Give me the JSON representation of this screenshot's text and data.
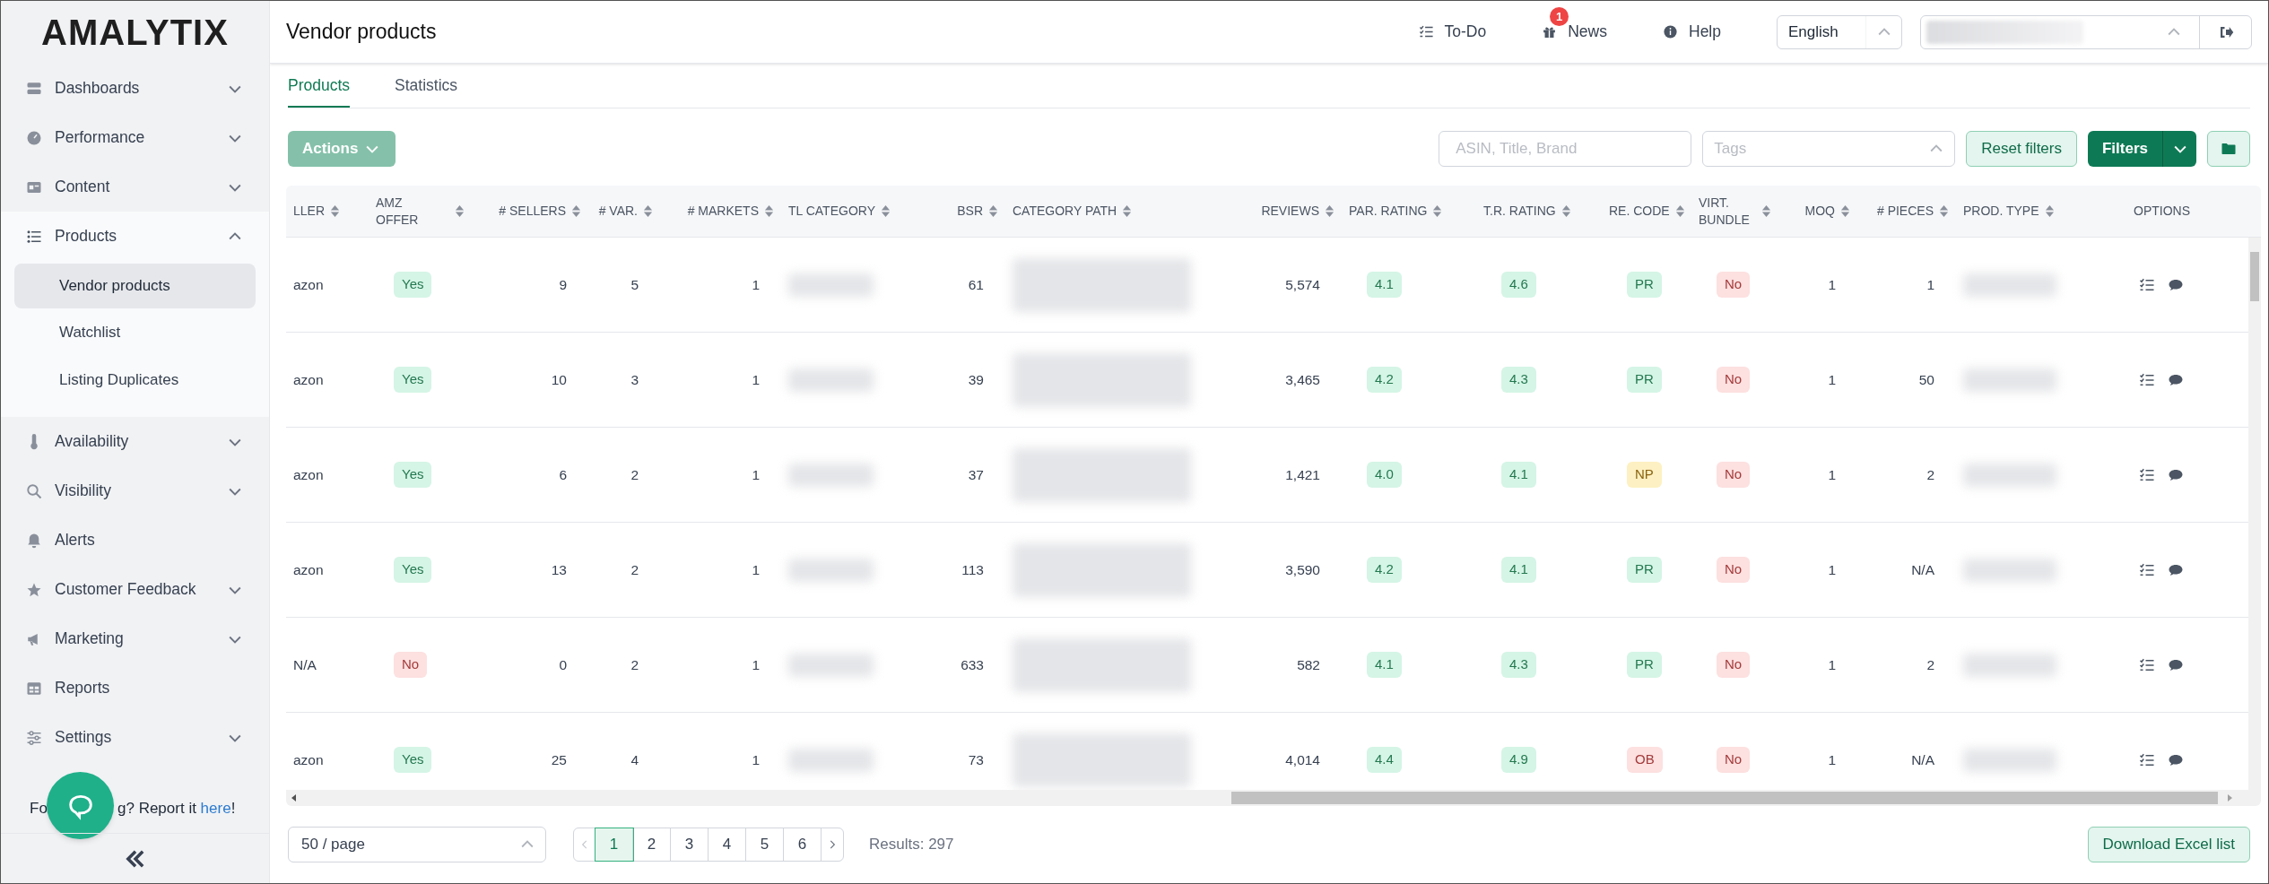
{
  "sidebar": {
    "logo": "AMALYTIX",
    "items": [
      {
        "label": "Dashboards",
        "kind": "dashboard",
        "expanded": false
      },
      {
        "label": "Performance",
        "kind": "gauge",
        "expanded": false
      },
      {
        "label": "Content",
        "kind": "card",
        "expanded": false
      },
      {
        "label": "Products",
        "kind": "list",
        "expanded": true,
        "children": [
          {
            "label": "Vendor products",
            "selected": true
          },
          {
            "label": "Watchlist",
            "selected": false
          },
          {
            "label": "Listing Duplicates",
            "selected": false
          }
        ]
      },
      {
        "label": "Availability",
        "kind": "thermometer",
        "expanded": false
      },
      {
        "label": "Visibility",
        "kind": "search",
        "expanded": false
      },
      {
        "label": "Alerts",
        "kind": "bell"
      },
      {
        "label": "Customer Feedback",
        "kind": "star",
        "expanded": false
      },
      {
        "label": "Marketing",
        "kind": "megaphone",
        "expanded": false
      },
      {
        "label": "Reports",
        "kind": "table"
      },
      {
        "label": "Settings",
        "kind": "sliders",
        "expanded": false
      }
    ],
    "report": {
      "before": "Fo",
      "after": "g? Report it ",
      "link": "here",
      "end": "!"
    }
  },
  "header": {
    "title": "Vendor products",
    "links": [
      {
        "label": "To-Do",
        "kind": "todo"
      },
      {
        "label": "News",
        "kind": "gift",
        "badge": "1"
      },
      {
        "label": "Help",
        "kind": "info"
      }
    ],
    "language": "English"
  },
  "tabs": [
    {
      "label": "Products",
      "selected": true
    },
    {
      "label": "Statistics",
      "selected": false
    }
  ],
  "toolbar": {
    "actions": "Actions",
    "search_placeholder": "ASIN, Title, Brand",
    "tags_placeholder": "Tags",
    "reset": "Reset filters",
    "filters": "Filters"
  },
  "table": {
    "columns": [
      {
        "label": "LLER",
        "kind": "text"
      },
      {
        "label": "AMZ OFFER",
        "kind": "badge"
      },
      {
        "label": "# SELLERS",
        "kind": "num"
      },
      {
        "label": "# VAR.",
        "kind": "num"
      },
      {
        "label": "# MARKETS",
        "kind": "num"
      },
      {
        "label": "TL CATEGORY",
        "kind": "blur"
      },
      {
        "label": "BSR",
        "kind": "num"
      },
      {
        "label": "CATEGORY PATH",
        "kind": "blur2"
      },
      {
        "label": "REVIEWS",
        "kind": "num"
      },
      {
        "label": "PAR. RATING",
        "kind": "badge"
      },
      {
        "label": "T.R. RATING",
        "kind": "badge"
      },
      {
        "label": "RE. CODE",
        "kind": "badge"
      },
      {
        "label": "VIRT. BUNDLE",
        "kind": "badge"
      },
      {
        "label": "MOQ",
        "kind": "num"
      },
      {
        "label": "# PIECES",
        "kind": "num"
      },
      {
        "label": "PROD. TYPE",
        "kind": "blur"
      },
      {
        "label": "OPTIONS",
        "kind": "options"
      }
    ],
    "rows": [
      {
        "cells": [
          {
            "text": "azon"
          },
          {
            "text": "Yes",
            "kind": "good"
          },
          {
            "text": "9"
          },
          {
            "text": "5"
          },
          {
            "text": "1"
          },
          {},
          {
            "text": "61"
          },
          {},
          {
            "text": "5,574"
          },
          {
            "text": "4.1",
            "kind": "good"
          },
          {
            "text": "4.6",
            "kind": "good"
          },
          {
            "text": "PR",
            "kind": "good"
          },
          {
            "text": "No",
            "kind": "bad"
          },
          {
            "text": "1"
          },
          {
            "text": "1"
          },
          {},
          {}
        ]
      },
      {
        "cells": [
          {
            "text": "azon"
          },
          {
            "text": "Yes",
            "kind": "good"
          },
          {
            "text": "10"
          },
          {
            "text": "3"
          },
          {
            "text": "1"
          },
          {},
          {
            "text": "39"
          },
          {},
          {
            "text": "3,465"
          },
          {
            "text": "4.2",
            "kind": "good"
          },
          {
            "text": "4.3",
            "kind": "good"
          },
          {
            "text": "PR",
            "kind": "good"
          },
          {
            "text": "No",
            "kind": "bad"
          },
          {
            "text": "1"
          },
          {
            "text": "50"
          },
          {},
          {}
        ]
      },
      {
        "cells": [
          {
            "text": "azon"
          },
          {
            "text": "Yes",
            "kind": "good"
          },
          {
            "text": "6"
          },
          {
            "text": "2"
          },
          {
            "text": "1"
          },
          {},
          {
            "text": "37"
          },
          {},
          {
            "text": "1,421"
          },
          {
            "text": "4.0",
            "kind": "good"
          },
          {
            "text": "4.1",
            "kind": "good"
          },
          {
            "text": "NP",
            "kind": "warn"
          },
          {
            "text": "No",
            "kind": "bad"
          },
          {
            "text": "1"
          },
          {
            "text": "2"
          },
          {},
          {}
        ]
      },
      {
        "cells": [
          {
            "text": "azon"
          },
          {
            "text": "Yes",
            "kind": "good"
          },
          {
            "text": "13"
          },
          {
            "text": "2"
          },
          {
            "text": "1"
          },
          {},
          {
            "text": "113"
          },
          {},
          {
            "text": "3,590"
          },
          {
            "text": "4.2",
            "kind": "good"
          },
          {
            "text": "4.1",
            "kind": "good"
          },
          {
            "text": "PR",
            "kind": "good"
          },
          {
            "text": "No",
            "kind": "bad"
          },
          {
            "text": "1"
          },
          {
            "text": "N/A"
          },
          {},
          {}
        ]
      },
      {
        "cells": [
          {
            "text": "N/A"
          },
          {
            "text": "No",
            "kind": "bad"
          },
          {
            "text": "0"
          },
          {
            "text": "2"
          },
          {
            "text": "1"
          },
          {},
          {
            "text": "633"
          },
          {},
          {
            "text": "582"
          },
          {
            "text": "4.1",
            "kind": "good"
          },
          {
            "text": "4.3",
            "kind": "good"
          },
          {
            "text": "PR",
            "kind": "good"
          },
          {
            "text": "No",
            "kind": "bad"
          },
          {
            "text": "1"
          },
          {
            "text": "2"
          },
          {},
          {}
        ]
      },
      {
        "cells": [
          {
            "text": "azon"
          },
          {
            "text": "Yes",
            "kind": "good"
          },
          {
            "text": "25"
          },
          {
            "text": "4"
          },
          {
            "text": "1"
          },
          {},
          {
            "text": "73"
          },
          {},
          {
            "text": "4,014"
          },
          {
            "text": "4.4",
            "kind": "good"
          },
          {
            "text": "4.9",
            "kind": "good"
          },
          {
            "text": "OB",
            "kind": "bad"
          },
          {
            "text": "No",
            "kind": "bad"
          },
          {
            "text": "1"
          },
          {
            "text": "N/A"
          },
          {},
          {}
        ]
      }
    ]
  },
  "footer": {
    "page_size": "50 / page",
    "pages": [
      {
        "label": "1",
        "selected": true
      },
      {
        "label": "2",
        "selected": false
      },
      {
        "label": "3",
        "selected": false
      },
      {
        "label": "4",
        "selected": false
      },
      {
        "label": "5",
        "selected": false
      },
      {
        "label": "6",
        "selected": false
      }
    ],
    "results": "Results: 297",
    "download": "Download Excel list"
  }
}
